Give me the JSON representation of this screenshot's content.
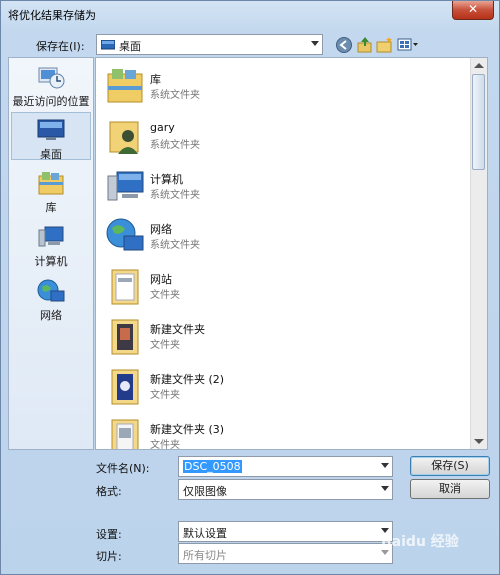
{
  "window": {
    "title": "将优化结果存储为",
    "close_label": "✕"
  },
  "toolbar": {
    "save_in_label": "保存在(I):",
    "location": "桌面",
    "icons": [
      "back-icon",
      "up-folder-icon",
      "new-folder-icon",
      "view-menu-icon"
    ]
  },
  "places": [
    {
      "label": "最近访问的位置",
      "icon": "recent-places-icon"
    },
    {
      "label": "桌面",
      "icon": "desktop-icon",
      "selected": true
    },
    {
      "label": "库",
      "icon": "library-icon"
    },
    {
      "label": "计算机",
      "icon": "computer-icon"
    },
    {
      "label": "网络",
      "icon": "network-icon"
    }
  ],
  "files": [
    {
      "name": "库",
      "type": "系统文件夹",
      "icon": "library-folder-icon"
    },
    {
      "name": "gary",
      "type": "系统文件夹",
      "icon": "user-folder-icon"
    },
    {
      "name": "计算机",
      "type": "系统文件夹",
      "icon": "computer-icon"
    },
    {
      "name": "网络",
      "type": "系统文件夹",
      "icon": "network-icon"
    },
    {
      "name": "网站",
      "type": "文件夹",
      "icon": "folder-icon"
    },
    {
      "name": "新建文件夹",
      "type": "文件夹",
      "icon": "folder-icon"
    },
    {
      "name": "新建文件夹 (2)",
      "type": "文件夹",
      "icon": "folder-icon"
    },
    {
      "name": "新建文件夹 (3)",
      "type": "文件夹",
      "icon": "folder-icon"
    }
  ],
  "form": {
    "filename_label": "文件名(N):",
    "filename_value": "DSC_0508",
    "format_label": "格式:",
    "format_value": "仅限图像",
    "settings_label": "设置:",
    "settings_value": "默认设置",
    "slices_label": "切片:",
    "slices_value": "所有切片"
  },
  "buttons": {
    "save": "保存(S)",
    "cancel": "取消"
  },
  "watermark": "Baidu 经验"
}
